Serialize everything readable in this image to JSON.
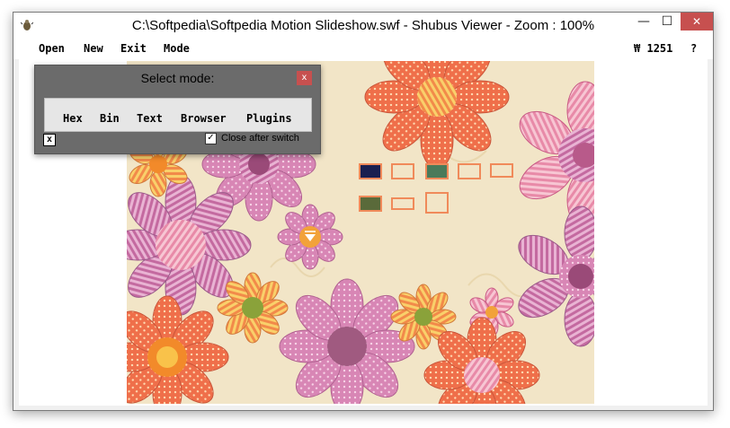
{
  "window": {
    "title": "C:\\Softpedia\\Softpedia Motion Slideshow.swf - Shubus Viewer - Zoom : 100%",
    "minimize_glyph": "—",
    "maximize_glyph": "☐",
    "close_glyph": "✕"
  },
  "menu": {
    "items": [
      "Open",
      "New",
      "Exit",
      "Mode"
    ],
    "counter_icon": "₩",
    "counter": "1251",
    "help": "?"
  },
  "dialog": {
    "title": "Select mode:",
    "close_glyph": "x",
    "modes": [
      "Hex",
      "Bin",
      "Text",
      "Browser",
      "Plugins"
    ],
    "x_button": "x",
    "checkbox_label": "Close after switch",
    "checkbox_checked": "✓"
  },
  "colors": {
    "stage_bg": "#f2e5c7",
    "accent_close": "#c7504f",
    "thumb_border": "#f08a5a",
    "dialog_bg": "#6b6b6b"
  },
  "icons": {
    "app": "bug-icon",
    "play": "play-triangle-icon"
  }
}
